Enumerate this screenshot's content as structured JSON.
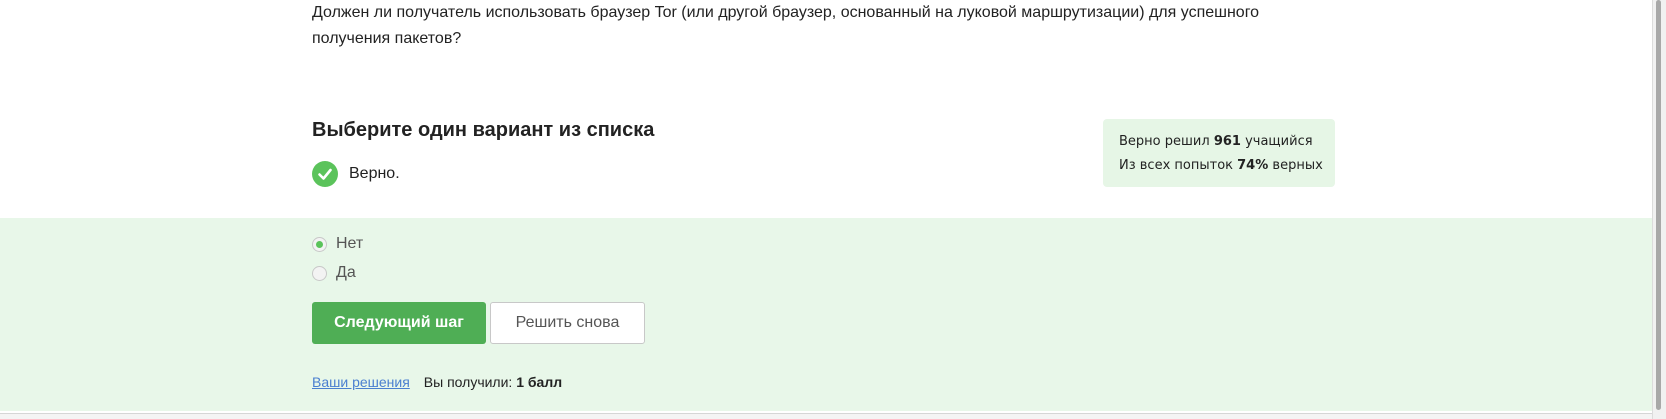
{
  "question": {
    "text": "Должен ли получатель использовать браузер Tor (или другой браузер, основанный на луковой маршрутизации) для успешного получения пакетов?"
  },
  "task": {
    "heading": "Выберите один вариант из списка",
    "verdict": "Верно."
  },
  "stats": {
    "solved_prefix": "Верно решил",
    "solved_count": "961",
    "solved_suffix": "учащийся",
    "attempts_prefix": "Из всех попыток",
    "attempts_percent": "74%",
    "attempts_suffix": "верных"
  },
  "options": [
    {
      "label": "Нет",
      "selected": true
    },
    {
      "label": "Да",
      "selected": false
    }
  ],
  "buttons": {
    "next": "Следующий шаг",
    "retry": "Решить снова"
  },
  "footer": {
    "solutions_link": "Ваши решения",
    "score_prefix": "Вы получили:",
    "score_value": "1 балл"
  },
  "colors": {
    "accent_green": "#4fae55",
    "band_bg": "#e8f7e9",
    "stats_bg": "#e6f6e6",
    "link": "#4a7fd0"
  },
  "icons": {
    "verdict": "check-circle-icon"
  }
}
